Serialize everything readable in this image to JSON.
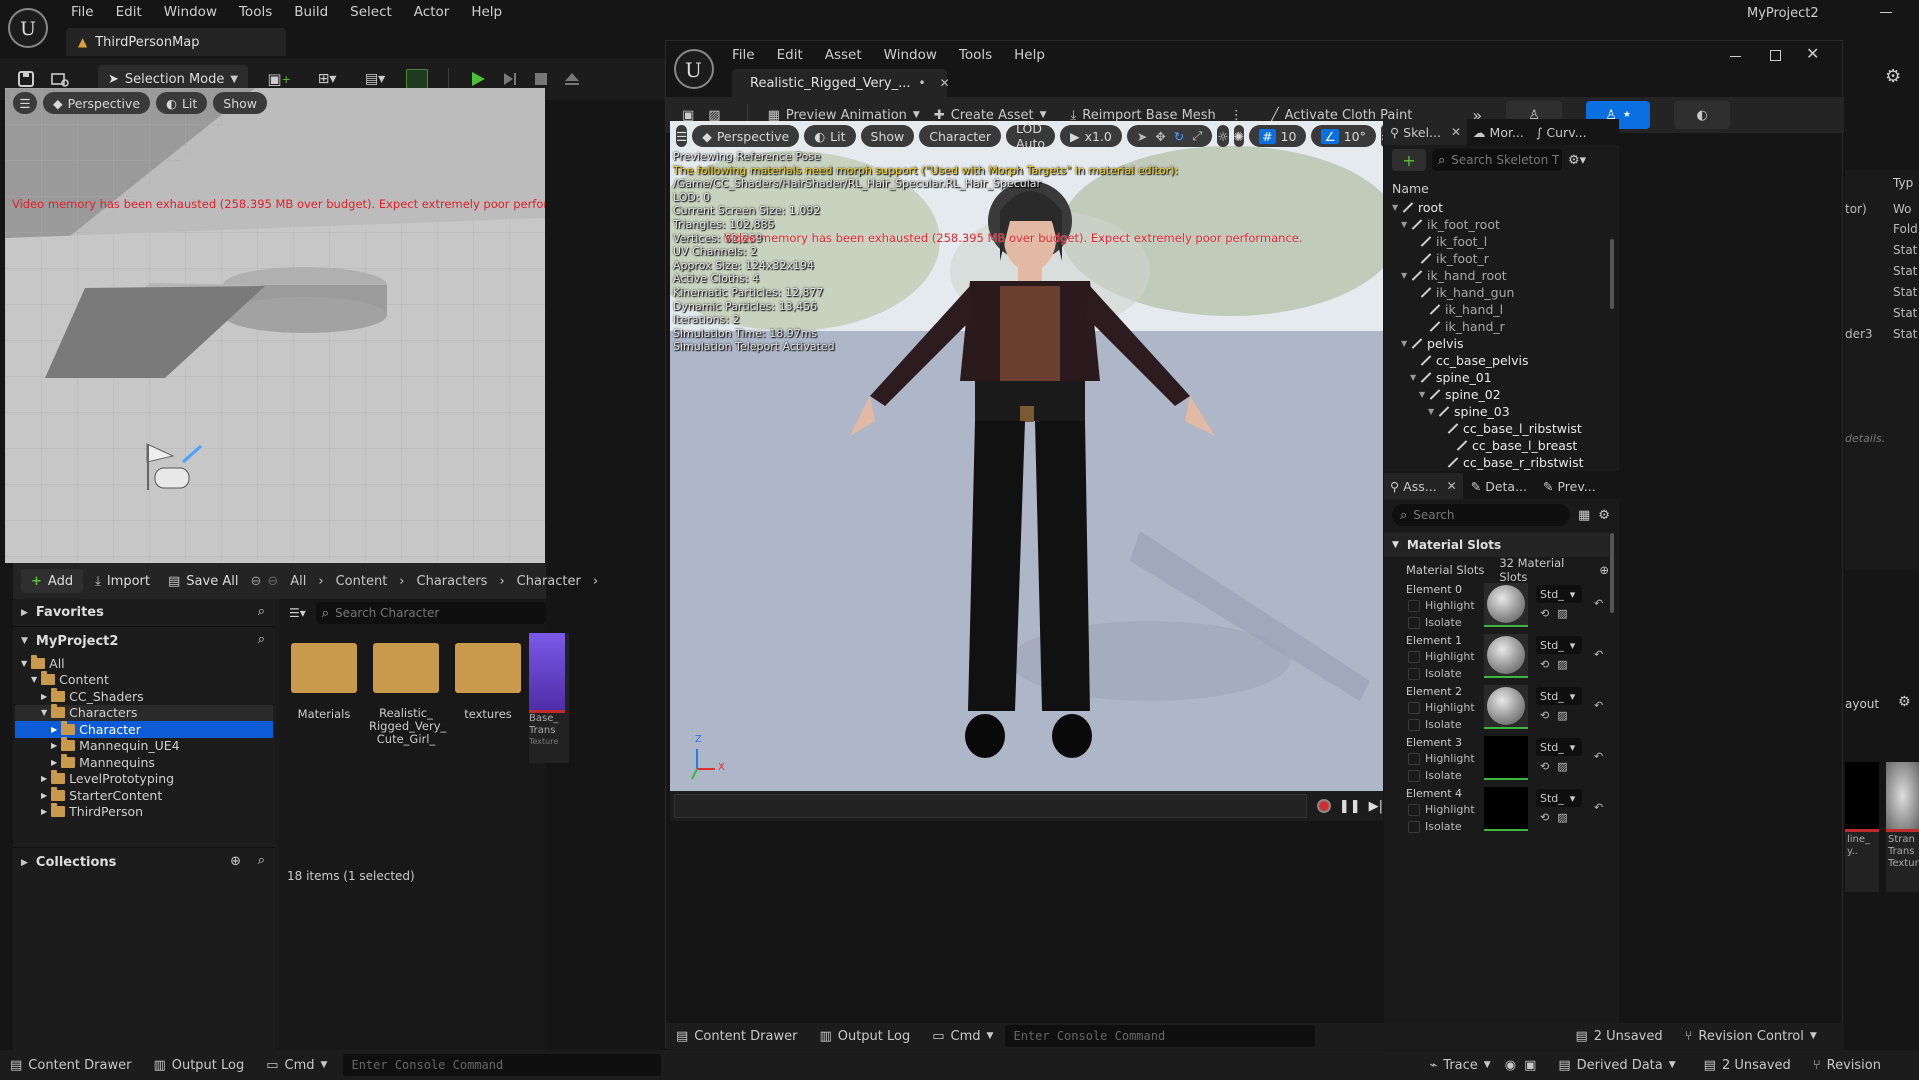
{
  "main": {
    "menu": [
      "File",
      "Edit",
      "Window",
      "Tools",
      "Build",
      "Select",
      "Actor",
      "Help"
    ],
    "project_name": "MyProject2",
    "level_tab": "ThirdPersonMap",
    "toolbar": {
      "selection_mode": "Selection Mode"
    },
    "viewport": {
      "perspective": "Perspective",
      "lit": "Lit",
      "show": "Show",
      "warning": "Video memory has been exhausted (258.395 MB over budget). Expect extremely poor performance."
    },
    "content_browser": {
      "add": "Add",
      "import": "Import",
      "save_all": "Save All",
      "breadcrumb": [
        "All",
        "Content",
        "Characters",
        "Character"
      ],
      "favorites": "Favorites",
      "project": "MyProject2",
      "search_placeholder": "Search Character",
      "tree": [
        {
          "label": "All",
          "depth": 0
        },
        {
          "label": "Content",
          "depth": 1
        },
        {
          "label": "CC_Shaders",
          "depth": 2
        },
        {
          "label": "Characters",
          "depth": 2
        },
        {
          "label": "Character",
          "depth": 3,
          "selected": true
        },
        {
          "label": "Mannequin_UE4",
          "depth": 3
        },
        {
          "label": "Mannequins",
          "depth": 3
        },
        {
          "label": "LevelPrototyping",
          "depth": 2
        },
        {
          "label": "StarterContent",
          "depth": 2
        },
        {
          "label": "ThirdPerson",
          "depth": 2
        }
      ],
      "assets": [
        {
          "label": "Materials"
        },
        {
          "label": "Realistic_ Rigged_Very_ Cute_Girl_"
        },
        {
          "label": "textures"
        },
        {
          "label": "Base_ Trans"
        }
      ],
      "asset_type_label": "Texture",
      "collections": "Collections",
      "status": "18 items (1 selected)"
    },
    "bottom_bar": {
      "content_drawer": "Content Drawer",
      "output_log": "Output Log",
      "cmd": "Cmd",
      "console_placeholder": "Enter Console Command",
      "trace": "Trace",
      "derived_data": "Derived Data",
      "unsaved": "2 Unsaved",
      "revision": "Revision"
    },
    "right_partial": {
      "type_header": "Typ",
      "rows": [
        "tor)",
        "Wo",
        "Fold",
        "Stat",
        "Stat",
        "Stat",
        "Stat",
        "der3"
      ],
      "rows_col2": [
        "",
        "",
        "",
        "",
        "",
        "",
        "",
        "Stat"
      ],
      "details_hint": "details.",
      "layout": "ayout",
      "thumb_label_1": "line_ y..",
      "thumb_label_2": "Stran Trans Texture"
    }
  },
  "editor": {
    "menu": [
      "File",
      "Edit",
      "Asset",
      "Window",
      "Tools",
      "Help"
    ],
    "tab_title": "Realistic_Rigged_Very_...",
    "toolbar": {
      "preview_animation": "Preview Animation",
      "create_asset": "Create Asset",
      "reimport": "Reimport Base Mesh",
      "cloth_paint": "Activate Cloth Paint"
    },
    "viewport": {
      "perspective": "Perspective",
      "lit": "Lit",
      "show": "Show",
      "character": "Character",
      "lod": "LOD Auto",
      "speed": "x1.0",
      "grid": "10",
      "angle": "10°",
      "stats": [
        {
          "text": "Previewing Reference Pose",
          "color": "#e6e6e6"
        },
        {
          "text": "The following materials need morph support (\"Used with Morph Targets\" in material editor):",
          "color": "#f2d12c"
        },
        {
          "text": "/Game/CC_Shaders/HairShader/RL_Hair_Specular.RL_Hair_Specular",
          "color": "#e6e6e6"
        },
        {
          "text": "LOD: 0",
          "color": "#e6e6e6"
        },
        {
          "text": "Current Screen Size: 1.092",
          "color": "#e6e6e6"
        },
        {
          "text": "Triangles: 102,885",
          "color": "#e6e6e6"
        },
        {
          "text": "Vertices: 62,259",
          "color": "#e6e6e6"
        },
        {
          "text": "UV Channels: 2",
          "color": "#e6e6e6"
        },
        {
          "text": "Approx Size: 124x32x194",
          "color": "#e6e6e6"
        },
        {
          "text": "Active Cloths: 4",
          "color": "#e6e6e6"
        },
        {
          "text": "Kinematic Particles: 12,877",
          "color": "#e6e6e6"
        },
        {
          "text": "Dynamic Particles: 13,456",
          "color": "#e6e6e6"
        },
        {
          "text": "Iterations: 2",
          "color": "#e6e6e6"
        },
        {
          "text": "Simulation Time: 18.97ms",
          "color": "#e6e6e6"
        },
        {
          "text": "Simulation Teleport Activated",
          "color": "#e6e6e6"
        }
      ],
      "warning": "Video memory has been exhausted (258.395 MB over budget). Expect extremely poor performance."
    },
    "skeleton": {
      "tabs": [
        "Skel...",
        "Mor...",
        "Curv..."
      ],
      "search_placeholder": "Search Skeleton T",
      "name_header": "Name",
      "bones": [
        {
          "label": "root",
          "depth": 0,
          "bright": true
        },
        {
          "label": "ik_foot_root",
          "depth": 1
        },
        {
          "label": "ik_foot_l",
          "depth": 2
        },
        {
          "label": "ik_foot_r",
          "depth": 2
        },
        {
          "label": "ik_hand_root",
          "depth": 1
        },
        {
          "label": "ik_hand_gun",
          "depth": 2
        },
        {
          "label": "ik_hand_l",
          "depth": 3
        },
        {
          "label": "ik_hand_r",
          "depth": 3
        },
        {
          "label": "pelvis",
          "depth": 1,
          "bright": true
        },
        {
          "label": "cc_base_pelvis",
          "depth": 2,
          "bright": true
        },
        {
          "label": "spine_01",
          "depth": 2,
          "bright": true
        },
        {
          "label": "spine_02",
          "depth": 3,
          "bright": true
        },
        {
          "label": "spine_03",
          "depth": 4,
          "bright": true
        },
        {
          "label": "cc_base_l_ribstwist",
          "depth": 5,
          "bright": true
        },
        {
          "label": "cc_base_l_breast",
          "depth": 6,
          "bright": true
        },
        {
          "label": "cc_base_r_ribstwist",
          "depth": 5,
          "bright": true
        }
      ]
    },
    "asset_details": {
      "tabs": [
        "Ass...",
        "Deta...",
        "Prev..."
      ],
      "search_placeholder": "Search",
      "section": "Material Slots",
      "slots_label": "Material Slots",
      "slots_count": "32 Material Slots",
      "highlight": "Highlight",
      "isolate": "Isolate",
      "std": "Std_",
      "elements": [
        {
          "label": "Element 0",
          "thumb": "sphere"
        },
        {
          "label": "Element 1",
          "thumb": "sphere"
        },
        {
          "label": "Element 2",
          "thumb": "sphere"
        },
        {
          "label": "Element 3",
          "thumb": "black"
        },
        {
          "label": "Element 4",
          "thumb": "black"
        }
      ]
    },
    "bottom_bar": {
      "content_drawer": "Content Drawer",
      "output_log": "Output Log",
      "cmd": "Cmd",
      "console_placeholder": "Enter Console Command",
      "unsaved": "2 Unsaved",
      "revision": "Revision Control"
    },
    "axis": {
      "z": "Z",
      "x": "X"
    }
  },
  "colors": {
    "accent": "#0a6fe0",
    "select": "#0d5bd6",
    "play": "#4fbf3a",
    "warning": "#e0202a",
    "yellow": "#f2d12c",
    "folder": "#c99a4b"
  }
}
